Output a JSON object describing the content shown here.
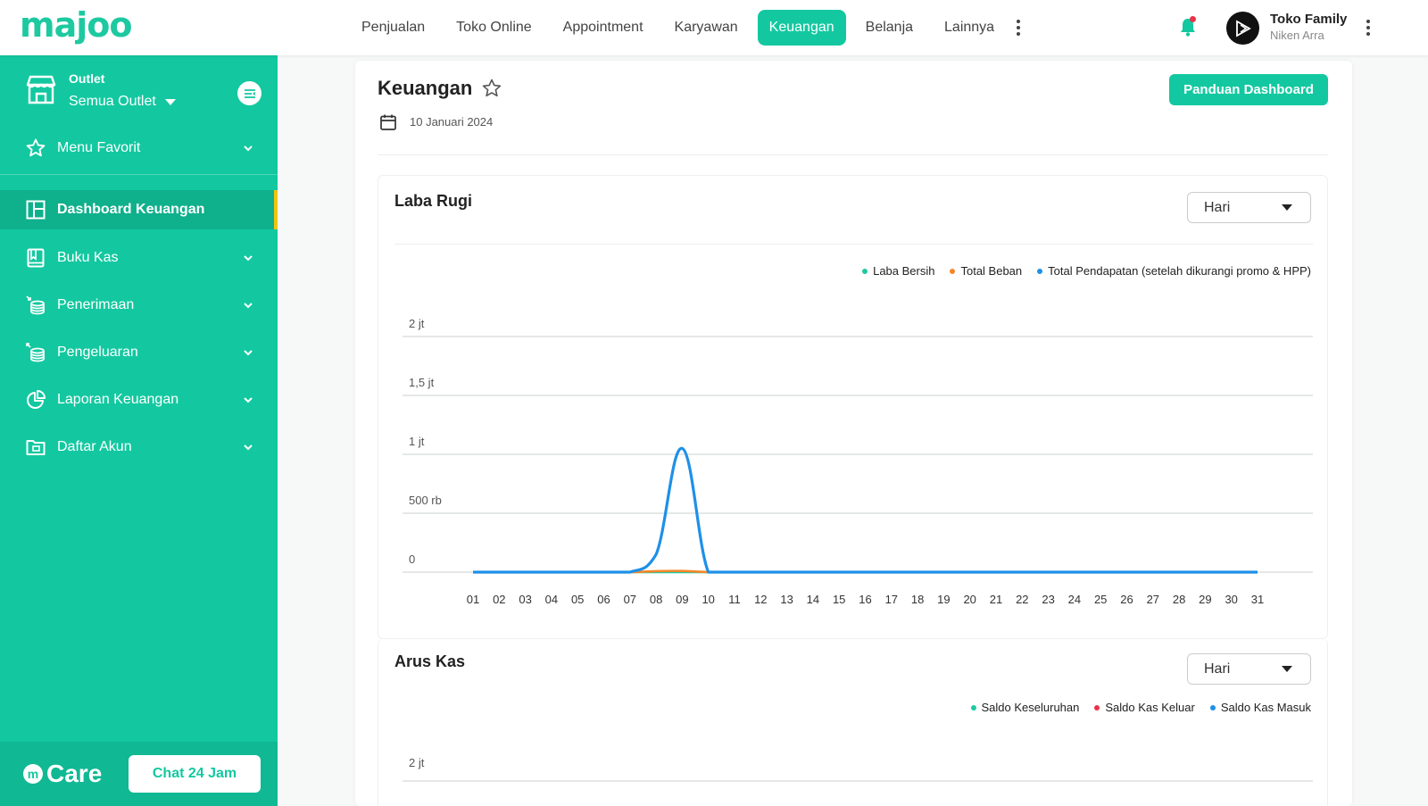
{
  "brand": {
    "logo_text": "majoo",
    "accent": "#13c8a0"
  },
  "nav": {
    "items": [
      {
        "label": "Penjualan",
        "active": false
      },
      {
        "label": "Toko Online",
        "active": false
      },
      {
        "label": "Appointment",
        "active": false
      },
      {
        "label": "Karyawan",
        "active": false
      },
      {
        "label": "Keuangan",
        "active": true
      },
      {
        "label": "Belanja",
        "active": false
      },
      {
        "label": "Lainnya",
        "active": false
      }
    ]
  },
  "user": {
    "name": "Toko Family",
    "sub": "Niken Arra"
  },
  "sidebar": {
    "outlet_label": "Outlet",
    "outlet_value": "Semua Outlet",
    "favorite_label": "Menu Favorit",
    "items": [
      {
        "label": "Dashboard Keuangan",
        "icon": "layout-icon",
        "active": true
      },
      {
        "label": "Buku Kas",
        "icon": "book-icon",
        "active": false
      },
      {
        "label": "Penerimaan",
        "icon": "coins-in-icon",
        "active": false
      },
      {
        "label": "Pengeluaran",
        "icon": "coins-out-icon",
        "active": false
      },
      {
        "label": "Laporan Keuangan",
        "icon": "pie-chart-icon",
        "active": false
      },
      {
        "label": "Daftar Akun",
        "icon": "folder-icon",
        "active": false
      }
    ],
    "care_label": "Care",
    "chat_button": "Chat 24 Jam"
  },
  "page": {
    "title": "Keuangan",
    "date": "10 Januari 2024",
    "guide_button": "Panduan Dashboard"
  },
  "laba_rugi": {
    "title": "Laba Rugi",
    "period": "Hari",
    "legend": [
      {
        "label": "Laba Bersih",
        "color": "#1dc9a0"
      },
      {
        "label": "Total Beban",
        "color": "#f5862a"
      },
      {
        "label": "Total Pendapatan (setelah dikurangi promo & HPP)",
        "color": "#1e90e8"
      }
    ]
  },
  "arus_kas": {
    "title": "Arus Kas",
    "period": "Hari",
    "legend": [
      {
        "label": "Saldo Keseluruhan",
        "color": "#1dc9a0"
      },
      {
        "label": "Saldo Kas Keluar",
        "color": "#e8334a"
      },
      {
        "label": "Saldo Kas Masuk",
        "color": "#1e90e8"
      }
    ],
    "y_tick_visible": "2 jt"
  },
  "chart_data": [
    {
      "type": "line",
      "title": "Laba Rugi",
      "xlabel": "",
      "ylabel": "",
      "y_ticks": [
        "0",
        "500 rb",
        "1 jt",
        "1,5 jt",
        "2 jt"
      ],
      "y_tick_values": [
        0,
        500000,
        1000000,
        1500000,
        2000000
      ],
      "ylim": [
        0,
        2000000
      ],
      "grid": true,
      "legend_position": "top-right",
      "categories": [
        "01",
        "02",
        "03",
        "04",
        "05",
        "06",
        "07",
        "08",
        "09",
        "10",
        "11",
        "12",
        "13",
        "14",
        "15",
        "16",
        "17",
        "18",
        "19",
        "20",
        "21",
        "22",
        "23",
        "24",
        "25",
        "26",
        "27",
        "28",
        "29",
        "30",
        "31"
      ],
      "series": [
        {
          "name": "Laba Bersih",
          "color": "#1dc9a0",
          "values": [
            0,
            0,
            0,
            0,
            0,
            0,
            0,
            0,
            0,
            0,
            0,
            0,
            0,
            0,
            0,
            0,
            0,
            0,
            0,
            0,
            0,
            0,
            0,
            0,
            0,
            0,
            0,
            0,
            0,
            0,
            0
          ]
        },
        {
          "name": "Total Beban",
          "color": "#f5862a",
          "values": [
            0,
            0,
            0,
            0,
            0,
            0,
            0,
            8000,
            10000,
            0,
            0,
            0,
            0,
            0,
            0,
            0,
            0,
            0,
            0,
            0,
            0,
            0,
            0,
            0,
            0,
            0,
            0,
            0,
            0,
            0,
            0
          ]
        },
        {
          "name": "Total Pendapatan (setelah dikurangi promo & HPP)",
          "color": "#1e90e8",
          "values": [
            0,
            0,
            0,
            0,
            0,
            0,
            0,
            150000,
            1050000,
            0,
            0,
            0,
            0,
            0,
            0,
            0,
            0,
            0,
            0,
            0,
            0,
            0,
            0,
            0,
            0,
            0,
            0,
            0,
            0,
            0,
            0
          ]
        }
      ]
    }
  ]
}
